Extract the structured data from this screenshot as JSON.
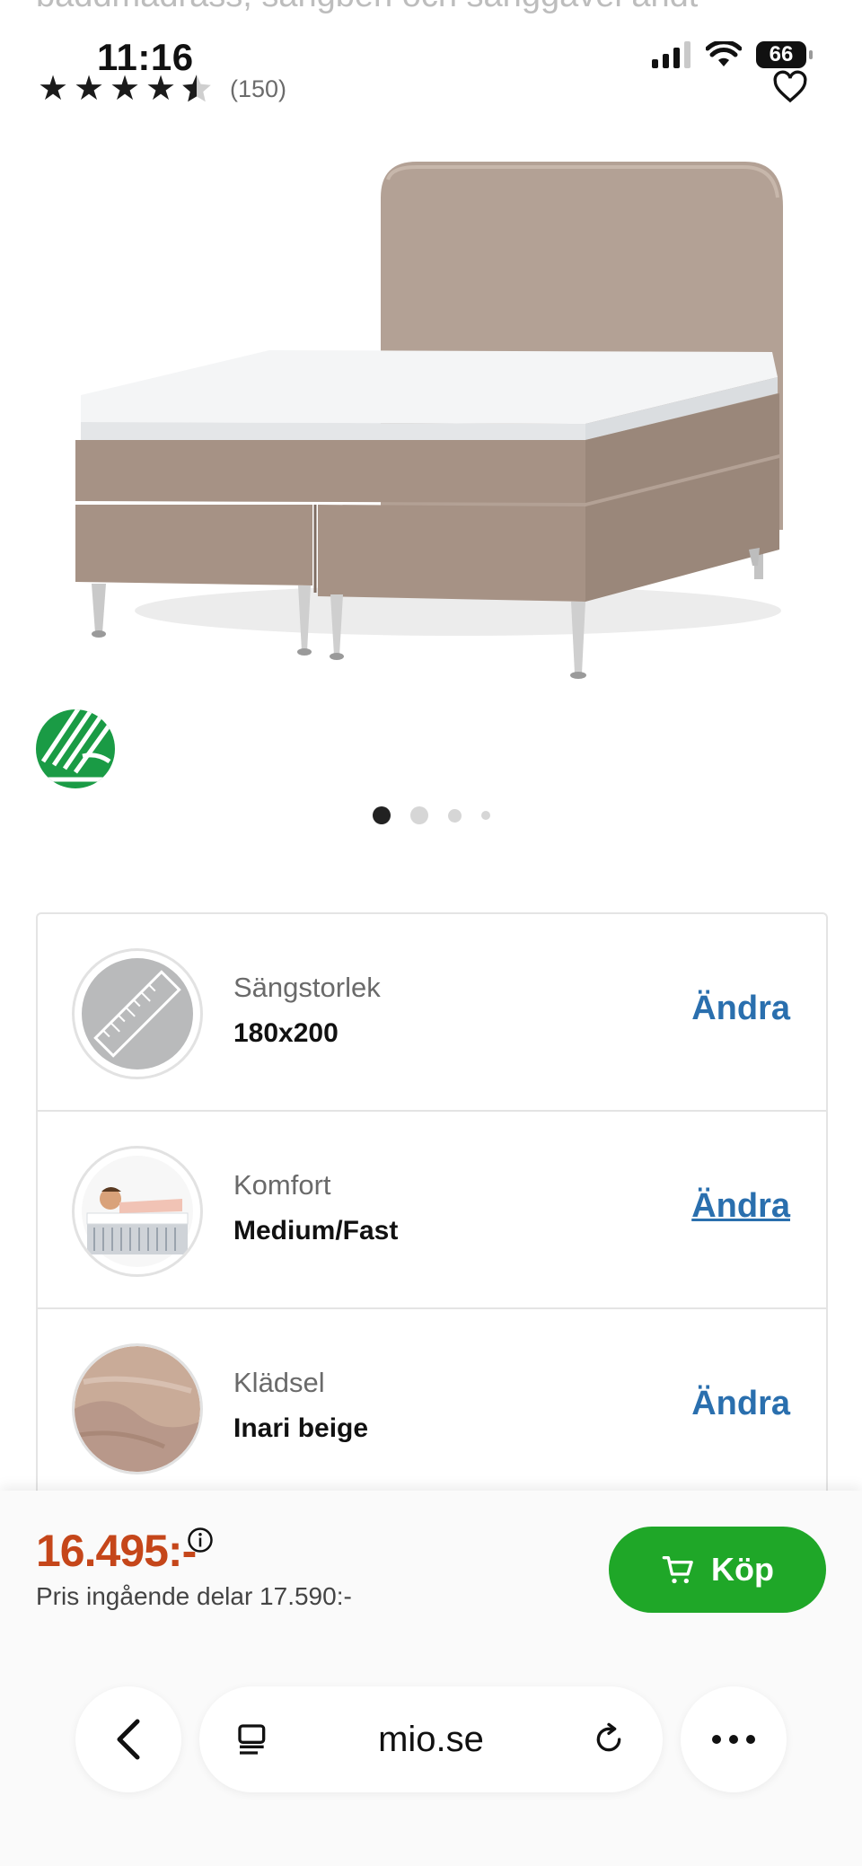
{
  "top": {
    "cut_text": "bäddmadrass, sängben och sänggavel ändt"
  },
  "status_bar": {
    "time": "11:16",
    "battery": "66"
  },
  "product": {
    "rating_count": "(150)",
    "rating_stars": 4.5,
    "image_dots": 4,
    "active_dot": 0
  },
  "options": [
    {
      "label": "Sängstorlek",
      "value": "180x200",
      "action": "Ändra",
      "icon": "ruler-icon"
    },
    {
      "label": "Komfort",
      "value": "Medium/Fast",
      "action": "Ändra",
      "icon": "comfort-icon"
    },
    {
      "label": "Klädsel",
      "value": "Inari beige",
      "action": "Ändra",
      "icon": "fabric-swatch-icon"
    }
  ],
  "purchase": {
    "price": "16.495:-",
    "price_sub": "Pris ingående delar 17.590:-",
    "buy_label": "Köp"
  },
  "browser": {
    "url": "mio.se"
  },
  "colors": {
    "accent_blue": "#2a6fae",
    "buy_green": "#1fa728",
    "price_orange": "#c5461a"
  }
}
